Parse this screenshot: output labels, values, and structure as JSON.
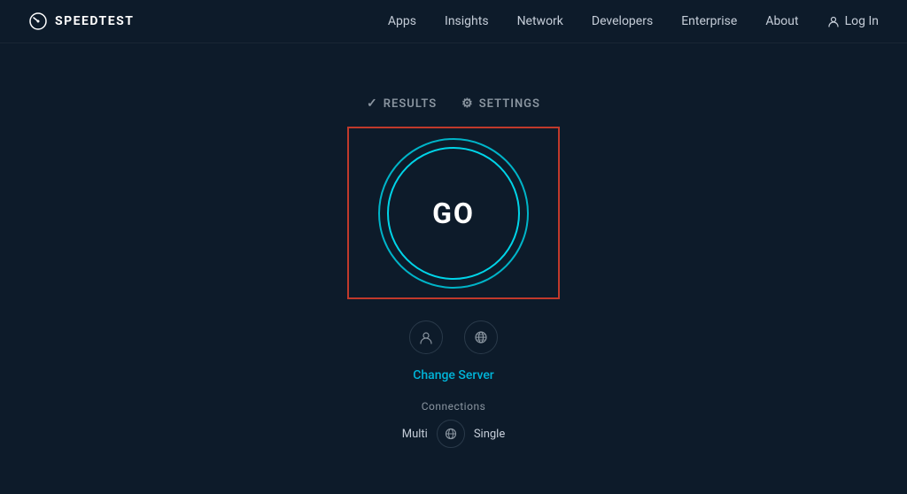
{
  "header": {
    "logo_text": "SPEEDTEST",
    "nav": {
      "items": [
        {
          "label": "Apps",
          "id": "apps"
        },
        {
          "label": "Insights",
          "id": "insights"
        },
        {
          "label": "Network",
          "id": "network"
        },
        {
          "label": "Developers",
          "id": "developers"
        },
        {
          "label": "Enterprise",
          "id": "enterprise"
        },
        {
          "label": "About",
          "id": "about"
        }
      ],
      "login_label": "Log In"
    }
  },
  "tabs": [
    {
      "label": "RESULTS",
      "icon": "✓"
    },
    {
      "label": "SETTINGS",
      "icon": "⚙"
    }
  ],
  "speedtest": {
    "go_label": "GO"
  },
  "change_server": {
    "label": "Change Server"
  },
  "connections": {
    "label": "Connections",
    "multi_label": "Multi",
    "single_label": "Single"
  }
}
